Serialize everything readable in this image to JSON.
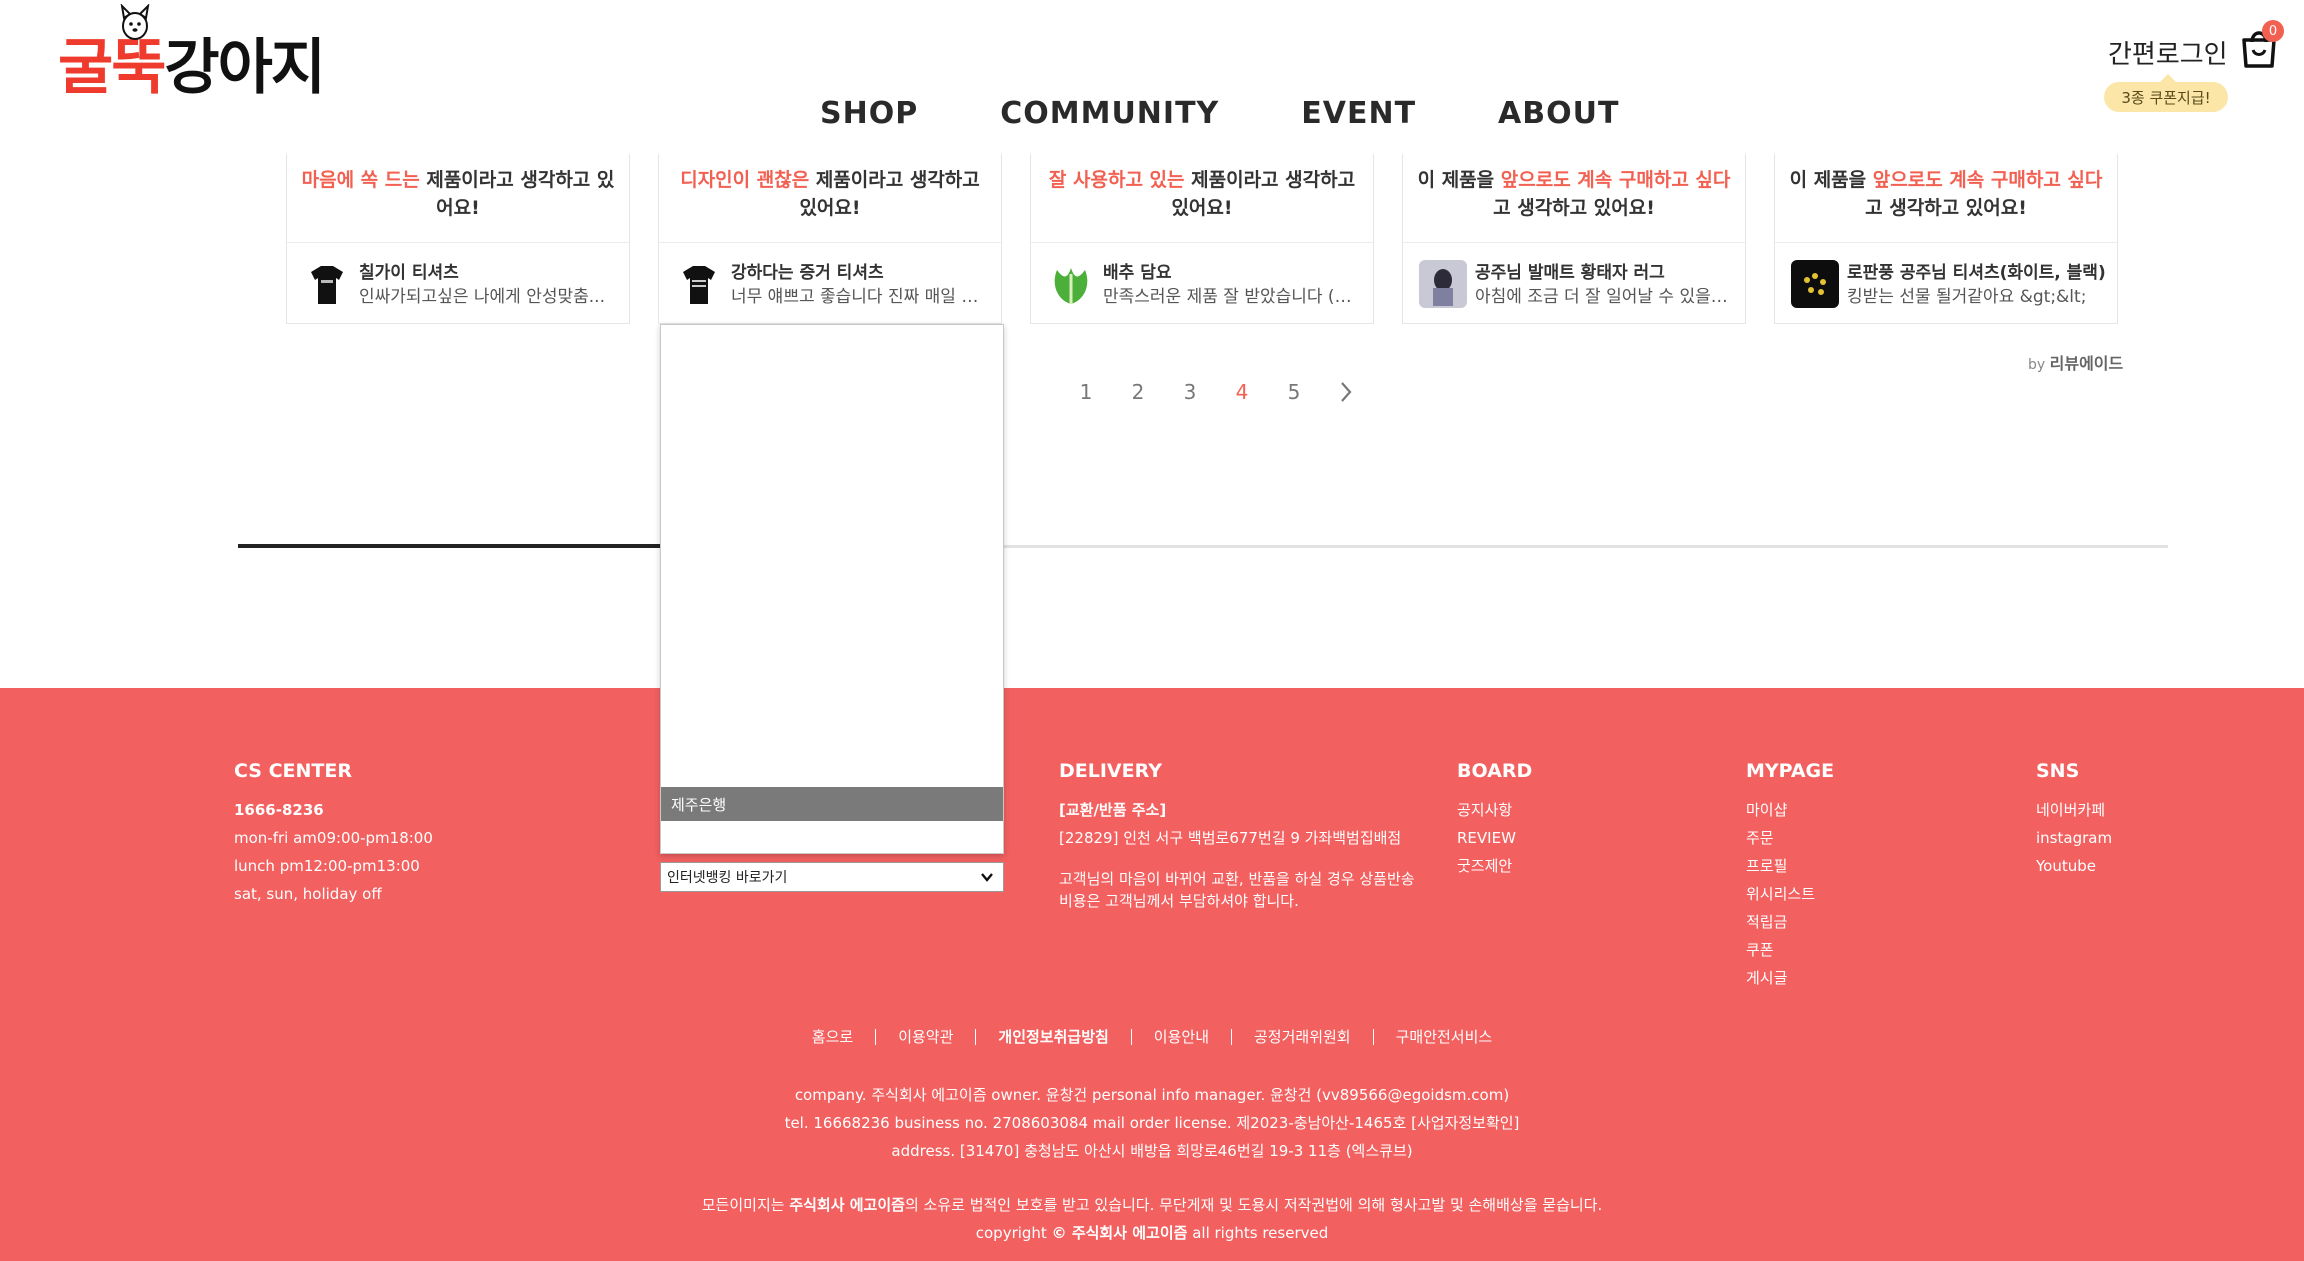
{
  "header": {
    "logo_red": "굴뚝",
    "logo_dark": "강아지",
    "nav": [
      "SHOP",
      "COMMUNITY",
      "EVENT",
      "ABOUT"
    ],
    "login_label": "간편로그인",
    "coupon_label": "3종 쿠폰지급!",
    "cart_count": "0"
  },
  "reviews": [
    {
      "hl": "마음에 쏙 드는",
      "rest": " 제품이라고 생각하고 있어요!",
      "product": "칠가이 티셔츠",
      "text": "인싸가되고싶은 나에게 안성맞춤...",
      "thumb_icon": "black-tshirt-icon"
    },
    {
      "hl": "디자인이 괜찮은",
      "rest": " 제품이라고 생각하고 있어요!",
      "product": "강하다는 증거 티셔츠",
      "text": "너무 얘쁘고 좋습니다 진짜 매일 입...",
      "thumb_icon": "black-tshirt-icon"
    },
    {
      "hl": "잘 사용하고 있는",
      "rest": " 제품이라고 생각하고 있어요!",
      "product": "배추 담요",
      "text": "만족스러운 제품 잘 받았습니다 (2...",
      "thumb_icon": "cabbage-blanket-icon"
    },
    {
      "pre": "이 제품을 ",
      "hl": "앞으로도 계속 구매하고 싶다",
      "rest": "고 생각하고 있어요!",
      "product": "공주님 발매트 황태자 러그",
      "text": "아침에 조금 더 잘 일어날 수 있을 ...",
      "thumb_icon": "rug-photo-icon"
    },
    {
      "pre": "이 제품을 ",
      "hl": "앞으로도 계속 구매하고 싶다",
      "rest": "고 생각하고 있어요!",
      "product": "로판풍 공주님 티셔츠(화이트, 블랙)",
      "text": "킹받는 선물 될거같아요 &gt;&lt;",
      "thumb_icon": "gold-print-tshirt-icon"
    }
  ],
  "byline": {
    "prefix": "by ",
    "brand": "리뷰에이드"
  },
  "pagination": {
    "pages": [
      "1",
      "2",
      "3",
      "4",
      "5"
    ],
    "current": "4"
  },
  "dropdown": {
    "selected_option": "제주은행",
    "select_value": "인터넷뱅킹 바로가기"
  },
  "footer": {
    "cs": {
      "title": "CS CENTER",
      "phone": "1666-8236",
      "hours": [
        "mon-fri am09:00-pm18:00",
        "lunch pm12:00-pm13:00",
        "sat, sun, holiday off"
      ]
    },
    "delivery": {
      "title": "DELIVERY",
      "addr_label": "[교환/반품 주소]",
      "addr": "[22829] 인천 서구 백범로677번길 9 가좌백범집배점",
      "note1": "고객님의 마음이 바뀌어 교환, 반품을 하실 경우 상품반송",
      "note2": "비용은 고객님께서 부담하셔야 합니다."
    },
    "board": {
      "title": "BOARD",
      "items": [
        "공지사항",
        "REVIEW",
        "굿즈제안"
      ]
    },
    "mypage": {
      "title": "MYPAGE",
      "items": [
        "마이샵",
        "주문",
        "프로필",
        "위시리스트",
        "적립금",
        "쿠폰",
        "게시글"
      ]
    },
    "sns": {
      "title": "SNS",
      "items": [
        "네이버카페",
        "instagram",
        "Youtube"
      ]
    },
    "links": [
      "홈으로",
      "이용약관",
      "개인정보취급방침",
      "이용안내",
      "공정거래위원회",
      "구매안전서비스"
    ],
    "info1": "company. 주식회사 에고이즘 owner. 윤창건 personal info manager. 윤창건 (vv89566@egoidsm.com)",
    "info2": "tel. 16668236 business no. 2708603084 mail order license. 제2023-충남아산-1465호 [사업자정보확인]",
    "info3": "address. [31470] 충청남도 아산시 배방읍 희망로46번길 19-3 11층 (엑스큐브)",
    "copy_pre": "모든이미지는 ",
    "copy_company": "주식회사 에고이즘",
    "copy_post": "의 소유로 법적인 보호를 받고 있습니다. 무단게재 및 도용시 저작권법에 의해 형사고발 및 손해배상을 묻습니다.",
    "copyright_pre": "copyright ",
    "copyright_company": "© 주식회사 에고이즘",
    "copyright_post": " all rights reserved"
  }
}
